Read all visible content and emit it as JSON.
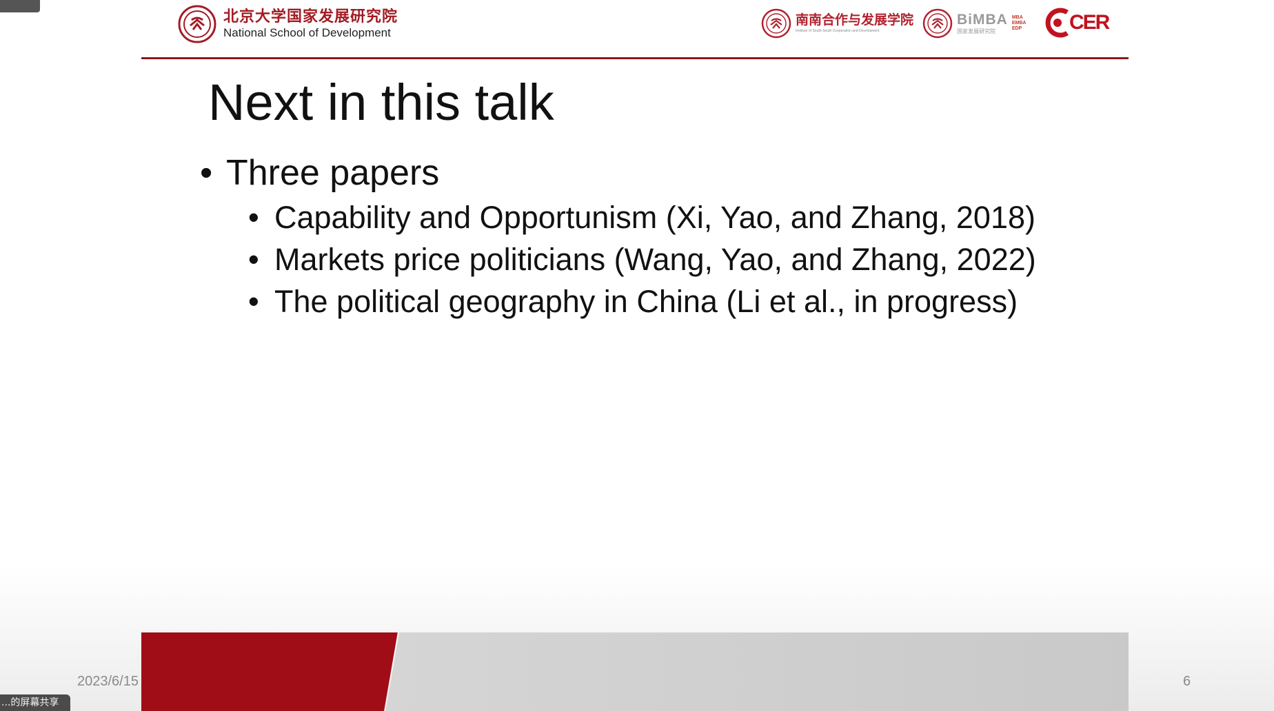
{
  "header": {
    "logo_main_cn": "北京大学国家发展研究院",
    "logo_main_en": "National School of Development",
    "logo_sscd_cn": "南南合作与发展学院",
    "logo_sscd_en": "Institute of South-South Cooperation and Development",
    "logo_bimba_word": "BiMBA",
    "logo_bimba_cn": "国家发展研究院",
    "logo_bimba_side": [
      "MBA",
      "EMBA",
      "EDP"
    ],
    "logo_ccer_word": "CER",
    "brand_color": "#a31b23",
    "rule_color": "#8b1a1a"
  },
  "slide": {
    "title": "Next in this talk",
    "bullet_main": "Three papers",
    "sub_bullets": [
      "Capability and Opportunism (Xi, Yao, and Zhang, 2018)",
      "Markets price politicians (Wang, Yao, and Zhang, 2022)",
      "The political geography in China (Li et al., in progress)"
    ]
  },
  "footer": {
    "date": "2023/6/15",
    "page_number": "6",
    "red_color": "#a00d16"
  },
  "overlay": {
    "top_left_badge": "",
    "bottom_left_badge": "...的屏幕共享"
  }
}
